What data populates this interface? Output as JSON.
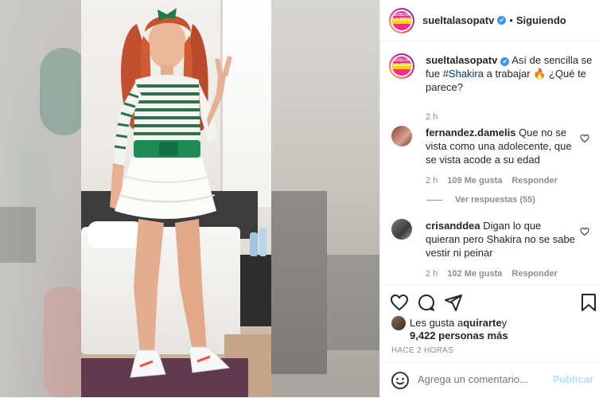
{
  "header": {
    "username": "sueltalasopatv",
    "verified_icon": "✔",
    "separator": "•",
    "follow_status": "Siguiendo",
    "logo_text": "SUELTA LA SOPA"
  },
  "caption": {
    "username": "sueltalasopatv",
    "text_before": "Así de sencilla se fue ",
    "hashtag": "#Shakira",
    "text_after": " a trabajar 🔥 ¿Qué te parece?",
    "time": "2 h"
  },
  "comments": [
    {
      "username": "fernandez.damelis",
      "text": "Que no se vista como una adolecente, que se vista acode a su edad",
      "time": "2 h",
      "likes": "109 Me gusta",
      "reply": "Responder"
    },
    {
      "username": "crisanddea",
      "text": "Digan lo que quieran pero Shakira no se sabe vestir ni peinar",
      "time": "2 h",
      "likes": "102 Me gusta",
      "reply": "Responder"
    }
  ],
  "view_replies": "Ver respuestas (55)",
  "likes": {
    "prefix": "Les gusta a ",
    "user": "quirarte",
    "suffix": " y",
    "count": "9,422 personas más"
  },
  "timestamp": "HACE 2 HORAS",
  "add_comment": {
    "placeholder": "Agrega un comentario...",
    "publish_label": "Publicar"
  },
  "icons": {
    "like": "heart-icon",
    "comment": "comment-icon",
    "share": "share-icon",
    "save": "bookmark-icon",
    "emoji": "emoji-icon"
  },
  "colors": {
    "verified": "#3897f0",
    "publish_disabled": "#b2dffc",
    "hashtag": "#00376b",
    "muted": "#8e8e8e"
  }
}
